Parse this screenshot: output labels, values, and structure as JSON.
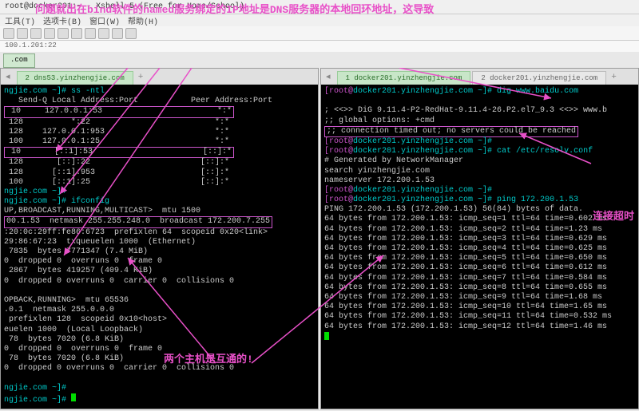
{
  "window": {
    "title": "root@docker201:~ - Xshell 5 (Free for Home/School)"
  },
  "menu": {
    "tools": "工具(T)",
    "tab": "选项卡(B)",
    "window": "窗口(W)",
    "help": "帮助(H)"
  },
  "addr": "100.1.201:22",
  "comtab": ".com",
  "annot": {
    "top": "问题就出在bind软件的named服务绑定的IP地址是DNS服务器的本地回环地址，这导致",
    "mid": "两个主机是互通的!",
    "timeout": "连接超时"
  },
  "left": {
    "tab": "2 dns53.yinzhengjie.com",
    "l01": "ngjie.com ~]# ss -ntl",
    "l02": "   Send-Q Local Address:Port           Peer Address:Port",
    "l03": " 10     127.0.0.1:53                        *:*",
    "l04": " 128          *:22                          *:*",
    "l05": " 128    127.0.0.1:953                       *:*",
    "l06": " 100    127.0.0.1:25                        *:*",
    "l07": " 10       [::1]:53                       [::]:*",
    "l08": " 128       [::]:22                       [::]:*",
    "l09": " 128      [::1]:953                      [::]:*",
    "l10": " 100      [::1]:25                       [::]:*",
    "l11": "ngjie.com ~]#",
    "l12": "ngjie.com ~]# ifconfig",
    "l13": "UP,BROADCAST,RUNNING,MULTICAST>  mtu 1500",
    "l14": "00.1.53  netmask 255.255.248.0  broadcast 172.200.7.255",
    "l15": ":20:0c:29ff:fe86:6723  prefixlen 64  scopeid 0x20<link>",
    "l16": "29:86:67:23  txqueuelen 1000  (Ethernet)",
    "l17": " 7835  bytes 7771347 (7.4 MiB)",
    "l18": "0  dropped 0  overruns 0  frame 0",
    "l19": " 2867  bytes 419257 (409.4 KiB)",
    "l20": "0  dropped 0 overruns 0  carrier 0  collisions 0",
    "l21": "OPBACK,RUNNING>  mtu 65536",
    "l22": ".0.1  netmask 255.0.0.0",
    "l23": " prefixlen 128  scopeid 0x10<host>",
    "l24": "euelen 1000  (Local Loopback)",
    "l25": " 78  bytes 7020 (6.8 KiB)",
    "l26": "0  dropped 0  overruns 0  frame 0",
    "l27": " 78  bytes 7020 (6.8 KiB)",
    "l28": "0  dropped 0 overruns 0  carrier 0  collisions 0",
    "l29": "ngjie.com ~]#",
    "l30": "ngjie.com ~]# "
  },
  "right": {
    "tab1": "1 docker201.yinzhengjie.com",
    "tab2": "2 docker201.yinzhengjie.com",
    "p1a": "[root@",
    "p1b": "docker201.yinzhengjie.com",
    "p1c": " ~]# dig www.baidu.com",
    "r01": "; <<>> DiG 9.11.4-P2-RedHat-9.11.4-26.P2.el7_9.3 <<>> www.b",
    "r02": ";; global options: +cmd",
    "r03": ";; connection timed out; no servers could be reached",
    "p2c": " ~]#",
    "p3c": " ~]# cat /etc/resolv.conf",
    "r04": "# Generated by NetworkManager",
    "r05": "search yinzhengjie.com",
    "r06": "nameserver 172.200.1.53",
    "p4c": " ~]#",
    "p5c": " ~]# ping 172.200.1.53",
    "r07": "PING 172.200.1.53 (172.200.1.53) 56(84) bytes of data.",
    "r08": "64 bytes from 172.200.1.53: icmp_seq=1 ttl=64 time=0.602 ms",
    "r09": "64 bytes from 172.200.1.53: icmp_seq=2 ttl=64 time=1.23 ms",
    "r10": "64 bytes from 172.200.1.53: icmp_seq=3 ttl=64 time=0.629 ms",
    "r11": "64 bytes from 172.200.1.53: icmp_seq=4 ttl=64 time=0.625 ms",
    "r12": "64 bytes from 172.200.1.53: icmp_seq=5 ttl=64 time=0.650 ms",
    "r13": "64 bytes from 172.200.1.53: icmp_seq=6 ttl=64 time=0.612 ms",
    "r14": "64 bytes from 172.200.1.53: icmp_seq=7 ttl=64 time=0.584 ms",
    "r15": "64 bytes from 172.200.1.53: icmp_seq=8 ttl=64 time=0.655 ms",
    "r16": "64 bytes from 172.200.1.53: icmp_seq=9 ttl=64 time=1.68 ms",
    "r17": "64 bytes from 172.200.1.53: icmp_seq=10 ttl=64 time=1.65 ms",
    "r18": "64 bytes from 172.200.1.53: icmp_seq=11 ttl=64 time=0.532 ms",
    "r19": "64 bytes from 172.200.1.53: icmp_seq=12 ttl=64 time=1.46 ms"
  }
}
